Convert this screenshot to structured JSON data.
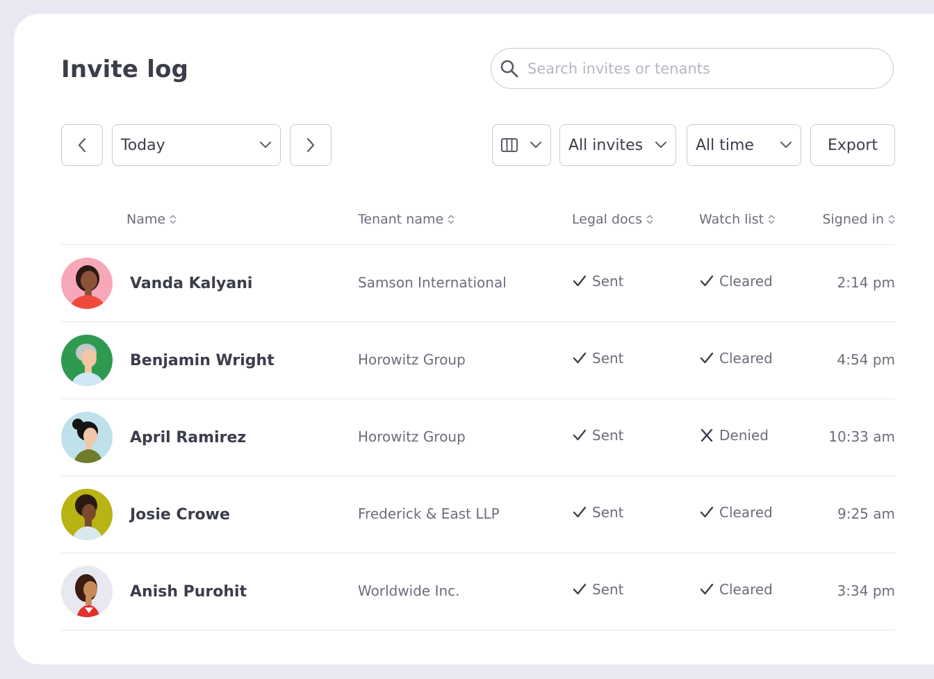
{
  "page": {
    "title": "Invite log"
  },
  "search": {
    "placeholder": "Search invites or tenants"
  },
  "toolbar": {
    "date_label": "Today",
    "invites_filter": "All invites",
    "time_filter": "All time",
    "export_label": "Export"
  },
  "table": {
    "headers": [
      "Name",
      "Tenant name",
      "Legal docs",
      "Watch list",
      "Signed in"
    ],
    "rows": [
      {
        "name": "Vanda Kalyani",
        "tenant": "Samson International",
        "legal": "Sent",
        "watch": "Cleared",
        "watch_icon": "check-icon",
        "time": "2:14 pm"
      },
      {
        "name": "Benjamin Wright",
        "tenant": "Horowitz Group",
        "legal": "Sent",
        "watch": "Cleared",
        "watch_icon": "check-icon",
        "time": "4:54 pm"
      },
      {
        "name": "April Ramirez",
        "tenant": "Horowitz Group",
        "legal": "Sent",
        "watch": "Denied",
        "watch_icon": "x-icon",
        "time": "10:33 am"
      },
      {
        "name": "Josie Crowe",
        "tenant": "Frederick & East LLP",
        "legal": "Sent",
        "watch": "Cleared",
        "watch_icon": "check-icon",
        "time": "9:25 am"
      },
      {
        "name": "Anish Purohit",
        "tenant": "Worldwide Inc.",
        "legal": "Sent",
        "watch": "Cleared",
        "watch_icon": "check-icon",
        "time": "3:34 pm"
      }
    ]
  },
  "colors": {
    "background": "#e9e9f3",
    "text": "#3b3d4a",
    "muted": "#6b6d7a",
    "border": "#c9cad3"
  }
}
